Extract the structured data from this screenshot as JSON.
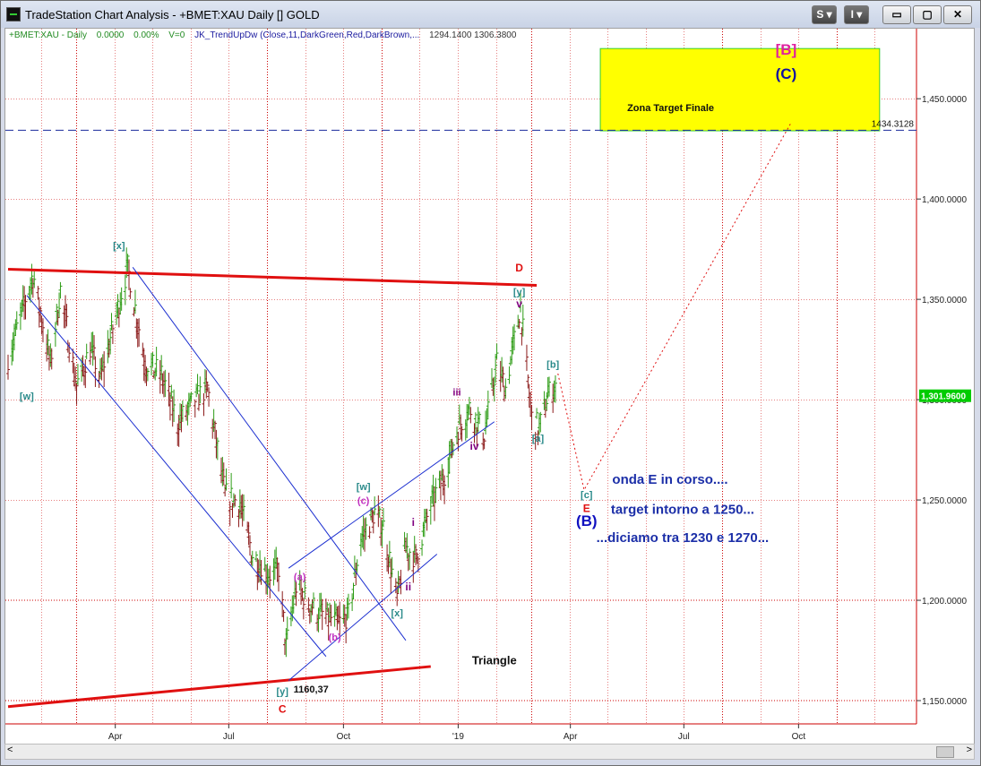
{
  "window": {
    "title": "TradeStation Chart Analysis - +BMET:XAU Daily [] GOLD",
    "buttons": {
      "s": "S ▾",
      "i": "I ▾",
      "minimize": "▭",
      "maximize": "▢",
      "close": "✕"
    }
  },
  "status": {
    "symbol": "+BMET:XAU - Daily",
    "change": "0.0000",
    "pct": "0.00%",
    "volume": "V=0",
    "indicator": "JK_TrendUpDw (Close,11,DarkGreen,Red,DarkBrown,...",
    "values": "1294.1400   1306.3800"
  },
  "colors": {
    "up_bar": "#2e9c16",
    "down_bar": "#8b1a1a",
    "trendline_red": "#e01010",
    "channel_blue": "#1c2fd0",
    "target_box": "#ffff00",
    "grid": "#cc0000",
    "current_price": "#00cc00"
  },
  "chart_data": {
    "type": "bar",
    "symbol": "+BMET:XAU",
    "timeframe": "Daily",
    "y_axis": {
      "ylim": [
        1125,
        1480
      ],
      "ticks": [
        "1,450.0000",
        "1,400.0000",
        "1,350.0000",
        "1,300.0000",
        "1,250.0000",
        "1,200.0000",
        "1,150.0000"
      ],
      "tick_values": [
        1450,
        1400,
        1350,
        1300,
        1250,
        1200,
        1150
      ]
    },
    "x_axis": {
      "range": [
        "2018-01-05",
        "2019-12-31"
      ],
      "labels": [
        "Apr",
        "Jul",
        "Oct",
        "'19",
        "Apr",
        "Jul",
        "Oct"
      ],
      "label_dates": [
        "2018-04-01",
        "2018-07-01",
        "2018-10-01",
        "2019-01-01",
        "2019-04-01",
        "2019-07-01",
        "2019-10-01"
      ],
      "gridline_dates": [
        "2018-02-01",
        "2018-03-01",
        "2018-04-01",
        "2018-05-01",
        "2018-06-01",
        "2018-07-01",
        "2018-08-01",
        "2018-09-01",
        "2018-10-01",
        "2018-11-01",
        "2018-12-01",
        "2019-01-01",
        "2019-02-01",
        "2019-03-01",
        "2019-04-01",
        "2019-05-01",
        "2019-06-01",
        "2019-07-01",
        "2019-08-01",
        "2019-09-01",
        "2019-10-01",
        "2019-11-01",
        "2019-12-01"
      ]
    },
    "price_path": [
      [
        "2018-01-05",
        1320
      ],
      [
        "2018-01-25",
        1362
      ],
      [
        "2018-02-08",
        1318
      ],
      [
        "2018-02-16",
        1354
      ],
      [
        "2018-03-01",
        1306
      ],
      [
        "2018-03-12",
        1325
      ],
      [
        "2018-03-20",
        1310
      ],
      [
        "2018-04-11",
        1365
      ],
      [
        "2018-04-25",
        1318
      ],
      [
        "2018-05-08",
        1312
      ],
      [
        "2018-05-21",
        1288
      ],
      [
        "2018-06-05",
        1300
      ],
      [
        "2018-06-14",
        1305
      ],
      [
        "2018-06-28",
        1252
      ],
      [
        "2018-07-10",
        1248
      ],
      [
        "2018-07-20",
        1222
      ],
      [
        "2018-08-03",
        1212
      ],
      [
        "2018-08-10",
        1215
      ],
      [
        "2018-08-16",
        1176
      ],
      [
        "2018-08-24",
        1206
      ],
      [
        "2018-09-05",
        1197
      ],
      [
        "2018-09-14",
        1192
      ],
      [
        "2018-09-28",
        1188
      ],
      [
        "2018-10-05",
        1192
      ],
      [
        "2018-10-15",
        1230
      ],
      [
        "2018-10-26",
        1243
      ],
      [
        "2018-11-02",
        1236
      ],
      [
        "2018-11-13",
        1200
      ],
      [
        "2018-11-20",
        1226
      ],
      [
        "2018-11-28",
        1220
      ],
      [
        "2018-12-10",
        1247
      ],
      [
        "2018-12-21",
        1262
      ],
      [
        "2018-12-31",
        1284
      ],
      [
        "2019-01-10",
        1295
      ],
      [
        "2019-01-22",
        1282
      ],
      [
        "2019-02-01",
        1318
      ],
      [
        "2019-02-08",
        1305
      ],
      [
        "2019-02-20",
        1346
      ],
      [
        "2019-03-01",
        1290
      ],
      [
        "2019-03-07",
        1285
      ],
      [
        "2019-03-14",
        1302
      ],
      [
        "2019-03-20",
        1307
      ]
    ],
    "current_price": {
      "value": 1301.96,
      "label": "1,301.9600"
    },
    "horizontal_line": {
      "value": 1434.3128,
      "label": "1434.3128"
    },
    "target_zone": {
      "x0": "2019-04-25",
      "x1": "2019-12-05",
      "y0": 1434,
      "y1": 1475,
      "label": "Zona Target Finale"
    },
    "trendlines": [
      {
        "role": "triangle-upper",
        "color": "red",
        "points": [
          [
            "2018-01-05",
            1365
          ],
          [
            "2019-03-05",
            1357
          ]
        ]
      },
      {
        "role": "triangle-lower",
        "color": "red",
        "points": [
          [
            "2018-01-05",
            1147
          ],
          [
            "2018-12-10",
            1167
          ]
        ]
      },
      {
        "role": "channel-down",
        "color": "blue",
        "points": [
          [
            "2018-01-20",
            1352
          ],
          [
            "2018-09-17",
            1172
          ]
        ]
      },
      {
        "role": "channel-down",
        "color": "blue",
        "points": [
          [
            "2018-04-15",
            1366
          ],
          [
            "2018-11-20",
            1180
          ]
        ]
      },
      {
        "role": "channel-up",
        "color": "blue",
        "points": [
          [
            "2018-08-18",
            1160
          ],
          [
            "2018-12-15",
            1223
          ]
        ]
      },
      {
        "role": "channel-up",
        "color": "blue",
        "points": [
          [
            "2018-08-18",
            1216
          ],
          [
            "2019-01-30",
            1289
          ]
        ]
      }
    ],
    "projection": [
      [
        "2019-03-22",
        1313
      ],
      [
        "2019-04-12",
        1255
      ],
      [
        "2019-09-25",
        1438
      ]
    ],
    "wave_labels": [
      {
        "text": "[x]",
        "date": "2018-04-04",
        "price": 1375,
        "color": "#2a8a8a"
      },
      {
        "text": "[w]",
        "date": "2018-01-20",
        "price": 1300,
        "color": "#2a8a8a"
      },
      {
        "text": "D",
        "date": "2019-02-19",
        "price": 1364,
        "color": "#e01010"
      },
      {
        "text": "[y]",
        "date": "2019-02-19",
        "price": 1352,
        "color": "#2a8a8a"
      },
      {
        "text": "v",
        "date": "2019-02-19",
        "price": 1346,
        "color": "#800080"
      },
      {
        "text": "iii",
        "date": "2018-12-31",
        "price": 1302,
        "color": "#800080"
      },
      {
        "text": "iv",
        "date": "2019-01-14",
        "price": 1275,
        "color": "#800080"
      },
      {
        "text": "[b]",
        "date": "2019-03-18",
        "price": 1316,
        "color": "#2a8a8a"
      },
      {
        "text": "[a]",
        "date": "2019-03-06",
        "price": 1279,
        "color": "#2a8a8a"
      },
      {
        "text": "[c]",
        "date": "2019-04-14",
        "price": 1251,
        "color": "#2a8a8a"
      },
      {
        "text": "E",
        "date": "2019-04-14",
        "price": 1244,
        "color": "#e01010"
      },
      {
        "text": "(B)",
        "date": "2019-04-14",
        "price": 1237,
        "color": "#1010c0"
      },
      {
        "text": "[w]",
        "date": "2018-10-17",
        "price": 1255,
        "color": "#2a8a8a"
      },
      {
        "text": "(c)",
        "date": "2018-10-17",
        "price": 1248,
        "color": "#c030c0"
      },
      {
        "text": "i",
        "date": "2018-11-26",
        "price": 1237,
        "color": "#800080"
      },
      {
        "text": "ii",
        "date": "2018-11-22",
        "price": 1205,
        "color": "#800080"
      },
      {
        "text": "[x]",
        "date": "2018-11-13",
        "price": 1192,
        "color": "#2a8a8a"
      },
      {
        "text": "(a)",
        "date": "2018-08-27",
        "price": 1210,
        "color": "#c030c0"
      },
      {
        "text": "(b)",
        "date": "2018-09-24",
        "price": 1180,
        "color": "#c030c0"
      },
      {
        "text": "[y]",
        "date": "2018-08-13",
        "price": 1153,
        "color": "#2a8a8a"
      },
      {
        "text": "C",
        "date": "2018-08-13",
        "price": 1144,
        "color": "#e01010"
      },
      {
        "text": "[B]",
        "date": "2019-09-21",
        "price": 1472,
        "color": "#e020a0"
      },
      {
        "text": "(C)",
        "date": "2019-09-21",
        "price": 1460,
        "color": "#1010a0"
      }
    ],
    "annotations": [
      {
        "text": "1160,37",
        "date": "2018-09-05",
        "price": 1154,
        "color": "#111111",
        "size": 11
      },
      {
        "text": "Triangle",
        "date": "2019-01-30",
        "price": 1168,
        "color": "#111111",
        "size": 13
      },
      {
        "text": "onda E in corso....",
        "date": "2019-06-20",
        "price": 1258,
        "color": "#1c2fa8",
        "size": 15
      },
      {
        "text": "target intorno a 1250...",
        "date": "2019-06-30",
        "price": 1243,
        "color": "#1c2fa8",
        "size": 15
      },
      {
        "text": "...diciamo tra 1230 e 1270...",
        "date": "2019-06-30",
        "price": 1229,
        "color": "#1c2fa8",
        "size": 15
      }
    ]
  }
}
